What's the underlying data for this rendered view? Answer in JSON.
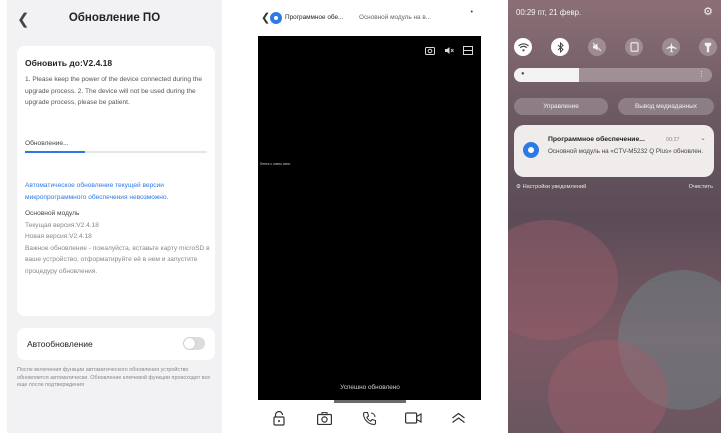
{
  "screen1": {
    "title": "Обновление ПО",
    "update_heading": "Обновить до:V2.4.18",
    "steps": "1. Please keep the power of the device connected during the upgrade process. 2. The device will not be used during the upgrade process, please be patient.",
    "progress_label": "Обновление...",
    "progress": 0.33,
    "auto_update_warning": "Автоматическое обновление текущей версии микропрограммного обеспечения невозможно.",
    "module_label": "Основной модуль",
    "current_version": "Текущая версия:V2.4.18",
    "new_version": "Новая версия:V2.4.18",
    "important_note": "Важное обновление - пожалуйста, вставьте карту microSD в ваше устройство, отформатируйте её в нем и запустите процедуру обновления.",
    "auto_update_label": "Автообновление",
    "auto_update_on": false,
    "footer_note": "После включения функции автоматического обновления устройство обновляется автоматически. Обновление ключевой функции происходит все еще после подтверждения"
  },
  "screen2": {
    "notif_title": "Программное обе...",
    "notif_body": "Основной модуль на в...",
    "ticker": "Лента с очень ясно",
    "toast": "Успешно обновлено",
    "icons": [
      "snapshot-icon",
      "speaker-muted-icon",
      "layout-icon"
    ],
    "toolbar_icons": [
      "unlock-icon",
      "camera-icon",
      "call-icon",
      "video-record-icon",
      "expand-up-icon"
    ]
  },
  "screen3": {
    "status_time": "00:29 пт, 21 февр.",
    "brightness": 0.33,
    "control_label": "Управление",
    "media_label": "Вывод медиаданных",
    "notif_title": "Программное обеспечение...",
    "notif_time": "00:27",
    "notif_body": "Основной модуль на «CTV-M5232 Q Plus» обновлен.",
    "notif_settings": "Настройки уведомлений",
    "clear_label": "Очистить",
    "quick_settings": [
      "wifi-icon",
      "bluetooth-icon",
      "mute-icon",
      "screen-icon",
      "airplane-icon",
      "flashlight-icon"
    ]
  }
}
